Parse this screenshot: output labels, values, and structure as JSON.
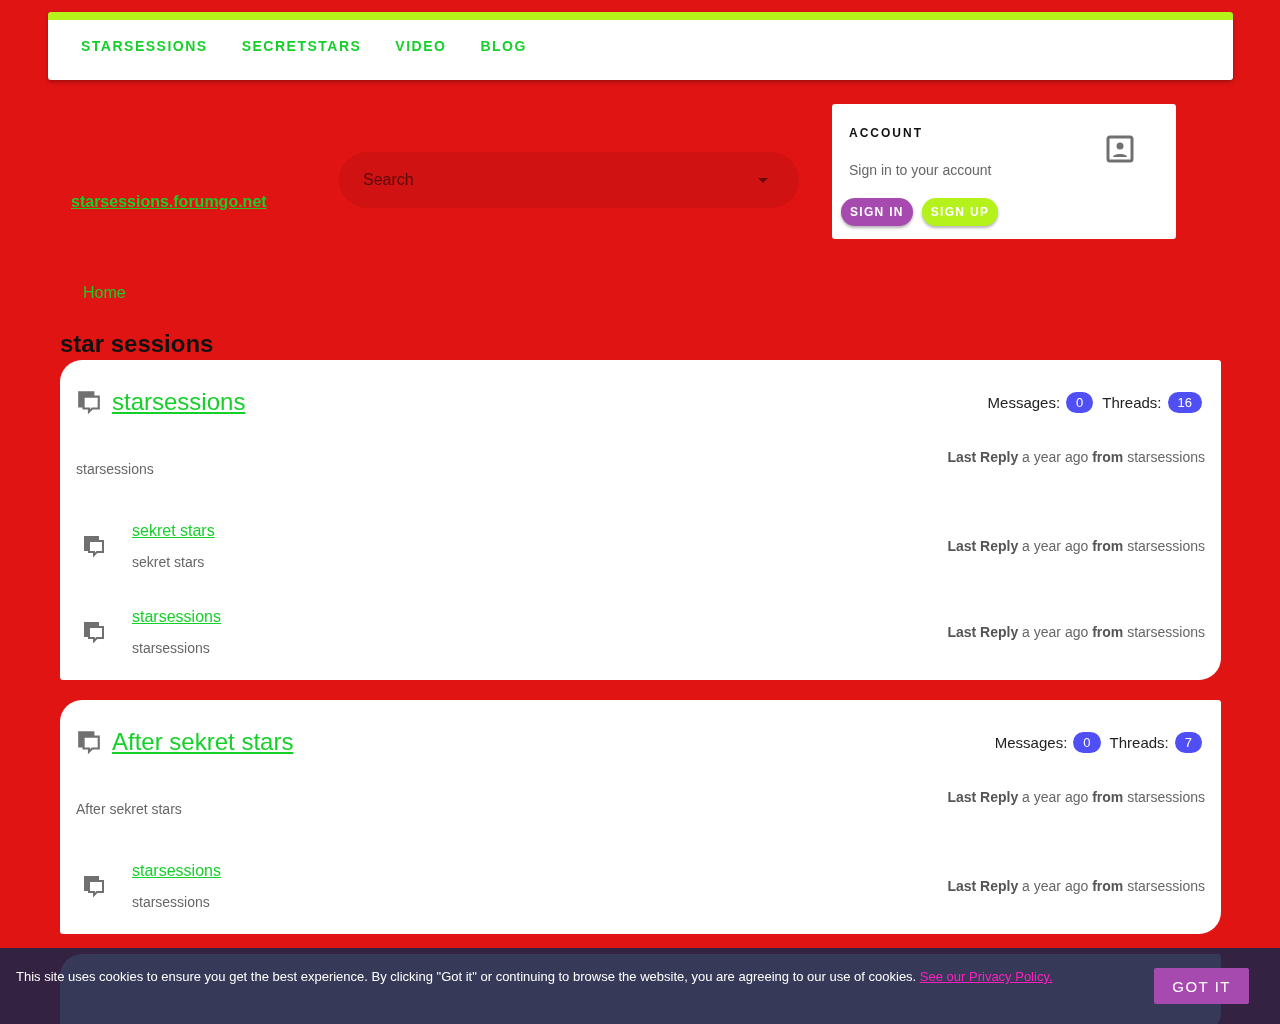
{
  "nav": {
    "links": [
      "STARSESSIONS",
      "SECRETSTARS",
      "VIDEO",
      "BLOG"
    ]
  },
  "header": {
    "site_link": "starsessions.forumgo.net",
    "search": {
      "placeholder": "Search"
    },
    "account": {
      "title": "ACCOUNT",
      "subtitle": "Sign in to your account",
      "buttons": [
        {
          "label": "SIGN IN",
          "kind": "signin"
        },
        {
          "label": "SIGN UP",
          "kind": "signup"
        }
      ]
    }
  },
  "breadcrumb": [
    "Home"
  ],
  "section_title": "star sessions",
  "forums": [
    {
      "title": "starsessions",
      "description": "starsessions",
      "messages_label": "Messages:",
      "messages": "0",
      "threads_label": "Threads:",
      "threads": "16",
      "last_reply": "**Last Reply** a year ago **from** starsessions",
      "subforums": [
        {
          "title": "sekret stars",
          "description": "sekret stars",
          "last_reply": "**Last Reply** a year ago **from** starsessions"
        },
        {
          "title": "starsessions",
          "description": "starsessions",
          "last_reply": "**Last Reply** a year ago **from** starsessions"
        }
      ]
    },
    {
      "title": "After sekret stars",
      "description": "After sekret stars",
      "messages_label": "Messages:",
      "messages": "0",
      "threads_label": "Threads:",
      "threads": "7",
      "last_reply": "**Last Reply** a year ago **from** starsessions",
      "subforums": [
        {
          "title": "starsessions",
          "description": "starsessions",
          "last_reply": "**Last Reply** a year ago **from** starsessions"
        }
      ]
    }
  ],
  "cookie_bar": {
    "text": "This site uses cookies to ensure you get the best experience. By clicking \"Got it\" or continuing to browse the website, you are agreeing to our use of cookies.",
    "link": "See our Privacy Policy.",
    "button": "GOT IT"
  }
}
